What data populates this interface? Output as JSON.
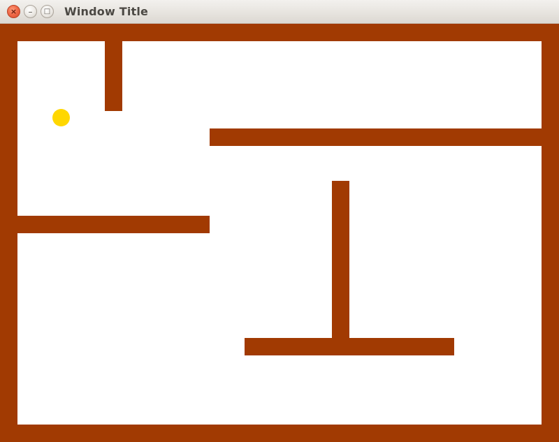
{
  "window": {
    "title": "Window Title",
    "controls": {
      "close": "×",
      "minimize": "–",
      "maximize": "□"
    }
  },
  "game": {
    "wall_color": "#a13a02",
    "ball_color": "#ffd700",
    "background_color": "#ffffff"
  }
}
